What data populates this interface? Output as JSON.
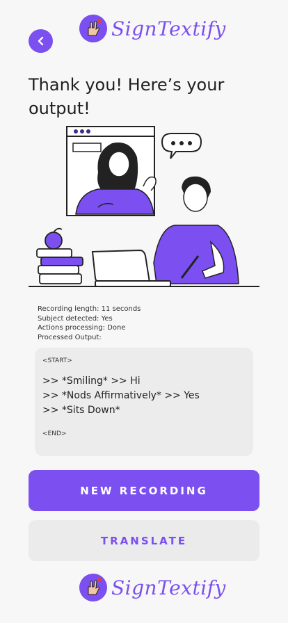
{
  "brand": {
    "name": "SignTextify",
    "accent": "#7b4ff0"
  },
  "header": {
    "back_icon": "chevron-left-icon"
  },
  "page": {
    "title": "Thank you! Here’s your output!"
  },
  "stats": {
    "recording_length": "Recording length: 11 seconds",
    "subject_detected": "Subject detected: Yes",
    "actions_processing": "Actions processing: Done",
    "processed_output_label": "Processed Output:"
  },
  "output": {
    "start_tag": "<START>",
    "lines": [
      ">> *Smiling* >> Hi",
      ">> *Nods Affirmatively* >> Yes",
      ">> *Sits Down*"
    ],
    "end_tag": "<END>"
  },
  "actions": {
    "new_recording_label": "NEW RECORDING",
    "translate_label": "TRANSLATE"
  }
}
